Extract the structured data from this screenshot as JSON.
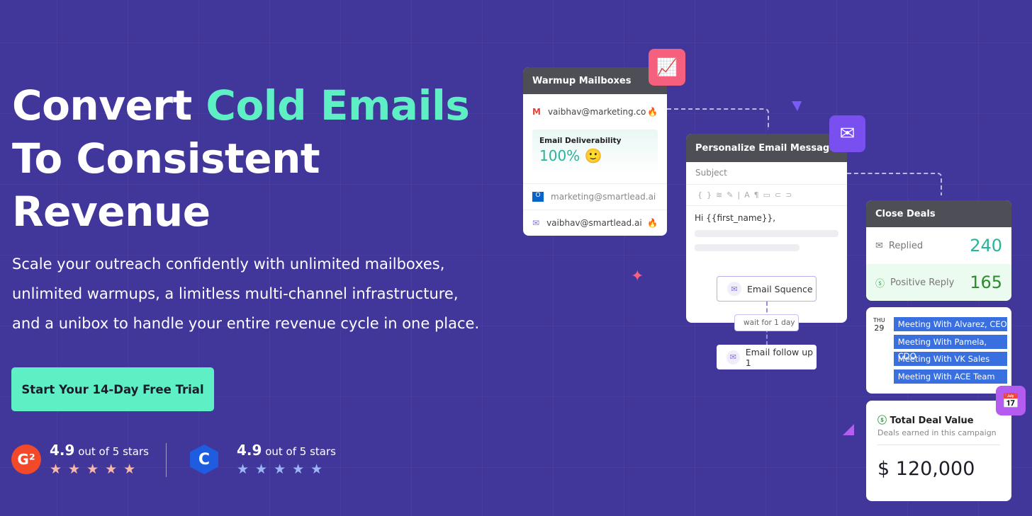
{
  "hero": {
    "title_pre": "Convert ",
    "title_accent": "Cold Emails",
    "title_line2": "To Consistent",
    "title_line3": "Revenue",
    "subtitle_lines": [
      "Scale your outreach confidently with unlimited mailboxes,",
      "unlimited warmups, a limitless multi-channel infrastructure,",
      "and a unibox to handle your entire revenue cycle in one place."
    ],
    "cta": "Start Your 14-Day Free Trial"
  },
  "ratings": [
    {
      "source": "G2",
      "score": "4.9",
      "suffix": " out of 5 stars",
      "stars": 5,
      "star_color": "#f7b8a8"
    },
    {
      "source": "Capterra",
      "score": "4.9",
      "suffix": " out of 5 stars",
      "stars": 5,
      "star_color": "#9db5f5"
    }
  ],
  "warmup": {
    "title": "Warmup Mailboxes",
    "mailbox1": "vaibhav@marketing.co",
    "deliv_label": "Email Deliverability",
    "deliv_value": "100%",
    "mailbox2": "marketing@smartlead.ai",
    "mailbox3": "vaibhav@smartlead.ai"
  },
  "personalize": {
    "title": "Personalize Email Message",
    "subject": "Subject",
    "body": "Hi {{first_name}},"
  },
  "sequence": {
    "step1": "Email Squence",
    "wait": "wait for 1 day",
    "step2": "Email follow up 1"
  },
  "close": {
    "title": "Close Deals",
    "replied_label": "Replied",
    "replied_value": "240",
    "positive_label": "Positive Reply",
    "positive_value": "165"
  },
  "calendar": {
    "day": "THU",
    "date": "29",
    "meetings": [
      "Meeting With Alvarez, CEO",
      "Meeting With Pamela, CDO",
      "Meeting With VK Sales",
      "Meeting With ACE Team"
    ]
  },
  "deal": {
    "title": "Total Deal Value",
    "subtitle": "Deals earned in this campaign",
    "value": "$ 120,000"
  },
  "colors": {
    "background": "#41369a",
    "accent": "#5ef0c4",
    "chart_icon": "#f5607e",
    "mail_icon": "#7a4ff0",
    "calendar_icon": "#b45cf0"
  }
}
